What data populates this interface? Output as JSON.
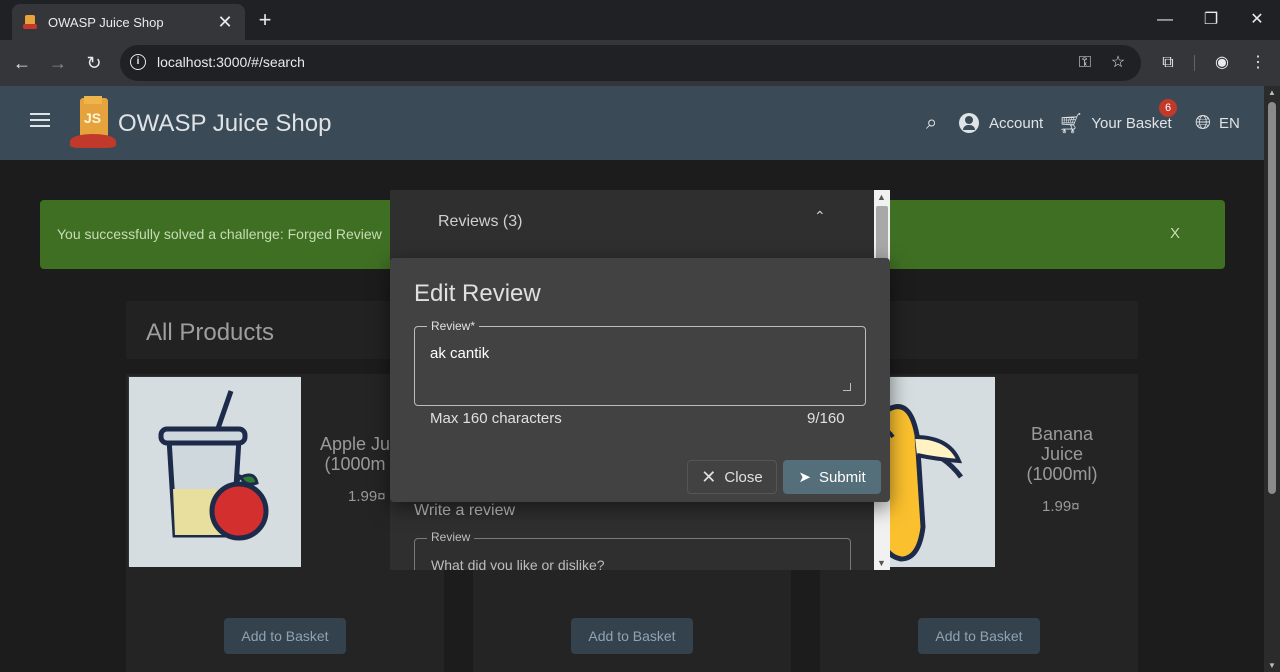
{
  "browser": {
    "tab_title": "OWASP Juice Shop",
    "tab_close": "✕",
    "new_tab": "+",
    "url": "localhost:3000/#/search",
    "window_controls": {
      "minimize": "—",
      "maximize": "❐",
      "close": "✕"
    }
  },
  "app": {
    "title": "OWASP Juice Shop",
    "logo_text": "JS",
    "nav": {
      "account": "Account",
      "basket": "Your Basket",
      "basket_count": "6",
      "language": "EN"
    }
  },
  "snackbar": {
    "message": "You successfully solved a challenge: Forged Review",
    "close": "X"
  },
  "products": {
    "heading": "All Products",
    "items": [
      {
        "name": "Apple Ju (1000m",
        "price": "1.99¤",
        "button": "Add to Basket"
      },
      {
        "name": "",
        "price": "",
        "button": "Add to Basket"
      },
      {
        "name": "Banana Juice (1000ml)",
        "price": "1.99¤",
        "button": "Add to Basket"
      }
    ]
  },
  "reviews_dialog": {
    "header": "Reviews (3)",
    "chevron": "⌃",
    "write_review": "Write a review",
    "review_label": "Review",
    "review_placeholder": "What did you like or dislike?"
  },
  "edit_dialog": {
    "title": "Edit Review",
    "field_label": "Review*",
    "value": "ak cantik",
    "hint": "Max 160 characters",
    "counter": "9/160",
    "close_label": "Close",
    "submit_label": "Submit"
  },
  "colors": {
    "toolbar": "#3a4a57",
    "snackbar": "#3f6f23",
    "accent_button": "#546e7a",
    "badge": "#c0392b"
  }
}
